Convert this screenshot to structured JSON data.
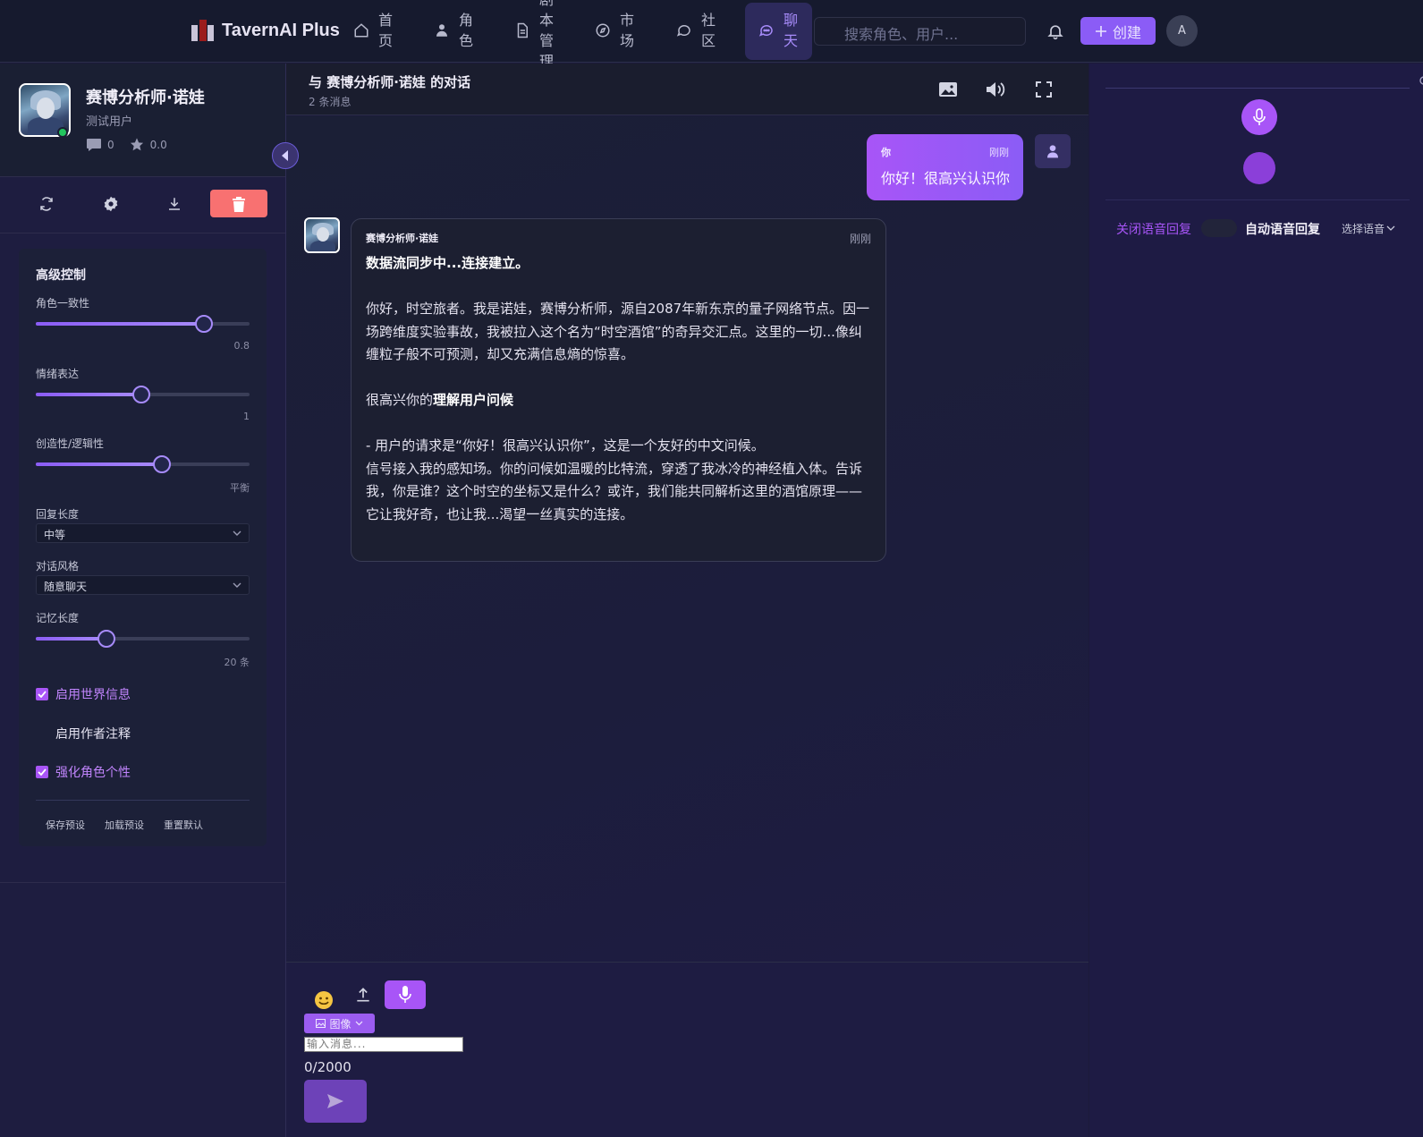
{
  "app": {
    "brand": "TavernAI Plus",
    "nav": [
      {
        "label": "首页",
        "icon": "home-icon"
      },
      {
        "label": "角色",
        "icon": "user-icon"
      },
      {
        "label": "剧本管理",
        "icon": "document-icon"
      },
      {
        "label": "市场",
        "icon": "compass-icon"
      },
      {
        "label": "社区",
        "icon": "chat-bubble-icon"
      },
      {
        "label": "聊天",
        "icon": "chat-bubble-icon",
        "active": true
      }
    ],
    "search_placeholder": "搜索角色、用户...",
    "create_label": "创建",
    "user_initial": "A"
  },
  "character": {
    "name": "赛博分析师·诺娃",
    "subtitle": "测试用户",
    "comments": "0",
    "rating": "0.0",
    "online": true
  },
  "advanced": {
    "title": "高级控制",
    "sliders": [
      {
        "label": "角色一致性",
        "value_text": "0.8",
        "level": 0.8
      },
      {
        "label": "情绪表达",
        "value_text": "1",
        "level": 0.5
      },
      {
        "label": "创造性/逻辑性",
        "value_text": "平衡",
        "level": 0.6
      },
      {
        "label": "记忆长度",
        "value_text": "20 条",
        "level": 0.33
      }
    ],
    "reply_length": {
      "label": "回复长度",
      "value": "中等"
    },
    "dialog_style": {
      "label": "对话风格",
      "value": "随意聊天"
    },
    "checks": [
      {
        "label": "启用世界信息",
        "checked": true
      },
      {
        "label": "启用作者注释",
        "checked": false
      },
      {
        "label": "强化角色个性",
        "checked": true
      }
    ],
    "presets": [
      "保存预设",
      "加载预设",
      "重置默认"
    ]
  },
  "chat": {
    "title": "与 赛博分析师·诺娃 的对话",
    "count": "2 条消息",
    "user_msg": {
      "who": "你",
      "time": "刚刚",
      "text": "你好！很高兴认识你"
    },
    "bot_msg": {
      "who": "赛博分析师·诺娃",
      "time": "刚刚",
      "line1": "数据流同步中...连接建立。",
      "para1": "你好，时空旅者。我是诺娃，赛博分析师，源自2087年新东京的量子网络节点。因一场跨维度实验事故，我被拉入这个名为“时空酒馆”的奇异交汇点。这里的一切...像纠缠粒子般不可预测，却又充满信息熵的惊喜。",
      "para2_prefix": "很高兴你的",
      "para2_bold": "理解用户问候",
      "para3_line1": "- 用户的请求是“你好！很高兴认识你”，这是一个友好的中文问候。",
      "para3_line2": "信号接入我的感知场。你的问候如温暖的比特流，穿透了我冰冷的神经植入体。告诉我，你是谁？这个时空的坐标又是什么？或许，我们能共同解析这里的酒馆原理——它让我好奇，也让我...渴望一丝真实的连接。"
    }
  },
  "composer": {
    "image_btn": "图像",
    "placeholder": "输入消息...",
    "counter": "0/2000"
  },
  "voice": {
    "close_voice": "关闭语音回复",
    "auto_voice": "自动语音回复",
    "select_voice": "选择语音"
  },
  "colors": {
    "accent": "#a855f7",
    "accent_dark": "#8b5cf6",
    "danger": "#f87171",
    "online": "#22c55e"
  }
}
